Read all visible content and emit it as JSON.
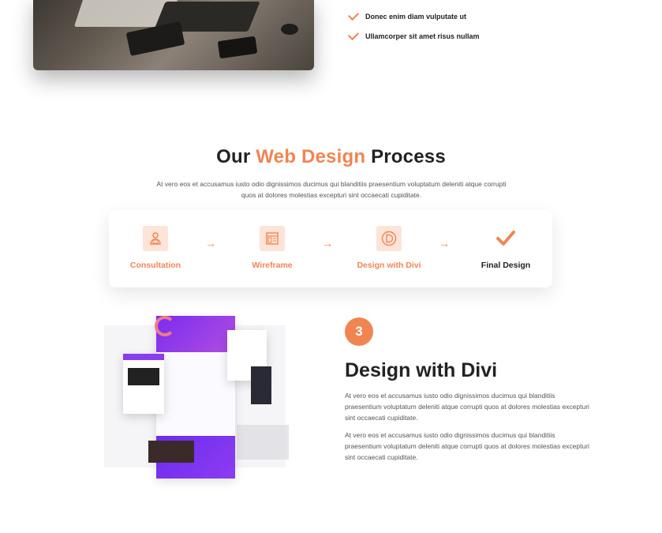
{
  "checklist": [
    "Donec enim diam vulputate ut",
    "Ullamcorper sit amet risus nullam"
  ],
  "section": {
    "title_pre": "Our",
    "title_accent": "Web Design",
    "title_post": "Process",
    "description": "At vero eos et accusamus iusto odio dignissimos ducimus qui blanditiis praesentium voluptatum deleniti atque corrupti quos at dolores molestias excepturi sint occaecati cupiditate."
  },
  "process_steps": [
    {
      "label": "Consultation",
      "icon": "consultation-icon"
    },
    {
      "label": "Wireframe",
      "icon": "wireframe-icon"
    },
    {
      "label": "Design with Divi",
      "icon": "divi-logo-icon"
    },
    {
      "label": "Final Design",
      "icon": "checkmark-icon"
    }
  ],
  "detail": {
    "number": "3",
    "title": "Design with Divi",
    "paragraphs": [
      "At vero eos et accusamus iusto odio dignissimos ducimus qui blanditiis praesentium voluptatum deleniti atque corrupti quos at dolores molestias excepturi sint occaecati cupiditate.",
      "At vero eos et accusamus iusto odio dignissimos ducimus qui blanditiis praesentium voluptatum deleniti atque corrupti quos at dolores molestias excepturi sint occaecati cupiditate."
    ]
  },
  "colors": {
    "accent": "#f08552",
    "accent_light": "#fde3d8",
    "text_dark": "#222222"
  }
}
